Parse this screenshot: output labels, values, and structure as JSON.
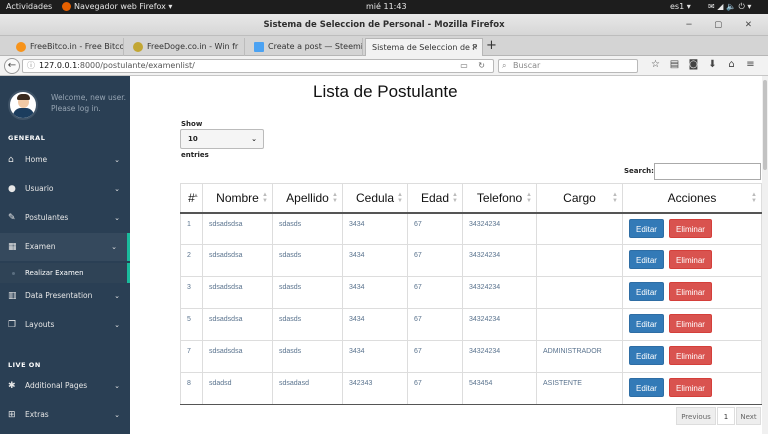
{
  "desktop": {
    "activities": "Actividades",
    "app_menu": "Navegador web Firefox ▾",
    "clock": "mié 11:43",
    "lang": "es1 ▾"
  },
  "window": {
    "title": "Sistema de Seleccion de Personal - Mozilla Firefox"
  },
  "tabs": [
    {
      "label": "FreeBitco.in - Free Bitco",
      "icon_color": "#f7931a"
    },
    {
      "label": "FreeDoge.co.in - Win fr",
      "icon_color": "#c2a633"
    },
    {
      "label": "Create a post — Steemi",
      "icon_color": "#4ba2f2"
    },
    {
      "label": "Sistema de Seleccion de P",
      "icon_color": "#ffffff"
    }
  ],
  "address": {
    "host": "127.0.0.1",
    "path": ":8000/postulante/examenlist/",
    "search_placeholder": "Buscar"
  },
  "sidebar": {
    "welcome_line1": "Welcome, new user.",
    "welcome_line2": "Please log in.",
    "general_title": "GENERAL",
    "live_title": "LIVE ON",
    "items": [
      {
        "label": "Home",
        "icon": "home-icon"
      },
      {
        "label": "Usuario",
        "icon": "user-icon"
      },
      {
        "label": "Postulantes",
        "icon": "edit-icon"
      },
      {
        "label": "Examen",
        "icon": "table-icon"
      },
      {
        "label": "Data Presentation",
        "icon": "bar-chart-icon"
      },
      {
        "label": "Layouts",
        "icon": "clone-icon"
      },
      {
        "label": "Additional Pages",
        "icon": "bug-icon"
      },
      {
        "label": "Extras",
        "icon": "windows-icon"
      }
    ],
    "submenu_item": "Realizar Examen",
    "accent_color": "#1abb9c",
    "bg_color": "#2a3f54"
  },
  "page": {
    "title": "Lista de Postulante",
    "show_label": "Show",
    "page_size": "10",
    "entries_label": "entries",
    "search_label": "Search:"
  },
  "table": {
    "headers": [
      "#",
      "Nombre",
      "Apellido",
      "Cedula",
      "Edad",
      "Telefono",
      "Cargo",
      "Acciones"
    ],
    "rows": [
      [
        "1",
        "sdsadsdsa",
        "sdasds",
        "3434",
        "67",
        "34324234",
        ""
      ],
      [
        "2",
        "sdsadsdsa",
        "sdasds",
        "3434",
        "67",
        "34324234",
        ""
      ],
      [
        "3",
        "sdsadsdsa",
        "sdasds",
        "3434",
        "67",
        "34324234",
        ""
      ],
      [
        "5",
        "sdsadsdsa",
        "sdasds",
        "3434",
        "67",
        "34324234",
        ""
      ],
      [
        "7",
        "sdsadsdsa",
        "sdasds",
        "3434",
        "67",
        "34324234",
        "ADMINISTRADOR"
      ],
      [
        "8",
        "sdadsd",
        "sdsadasd",
        "342343",
        "67",
        "543454",
        "ASISTENTE"
      ]
    ],
    "edit_label": "Editar",
    "delete_label": "Eliminar"
  },
  "pagination": {
    "previous": "Previous",
    "current": "1",
    "next": "Next"
  }
}
